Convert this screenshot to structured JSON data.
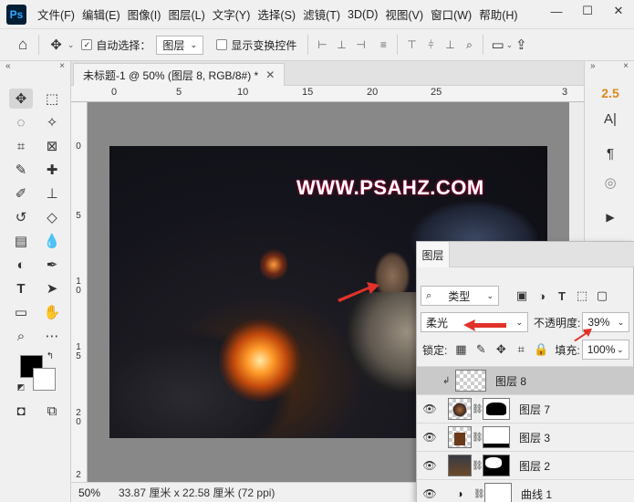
{
  "app": {
    "logo": "Ps"
  },
  "menu": [
    "文件(F)",
    "编辑(E)",
    "图像(I)",
    "图层(L)",
    "文字(Y)",
    "选择(S)",
    "滤镜(T)",
    "3D(D)",
    "视图(V)",
    "窗口(W)",
    "帮助(H)"
  ],
  "window_controls": {
    "minimize": "—",
    "maximize": "☐",
    "close": "✕"
  },
  "options": {
    "auto_select_label": "自动选择：",
    "auto_select_value": "图层",
    "show_transform_label": "显示变换控件"
  },
  "document": {
    "tab_title": "未标题-1 @ 50% (图层 8, RGB/8#) *",
    "zoom": "50%",
    "info": "33.87 厘米 x 22.58 厘米 (72 ppi)",
    "canvas_text": "WWW.PSAHZ.COM"
  },
  "rulers": {
    "h_labels": [
      "0",
      "5",
      "10",
      "15",
      "20",
      "25",
      "3"
    ],
    "v_labels": [
      "0",
      "5",
      "10",
      "15",
      "20",
      "2"
    ]
  },
  "right_panel": {
    "size_value": "2.5"
  },
  "layers_panel": {
    "tab_label": "图层",
    "filter_label": "类型",
    "blend_mode": "柔光",
    "opacity_label": "不透明度:",
    "opacity_value": "39%",
    "lock_label": "锁定:",
    "fill_label": "填充:",
    "fill_value": "100%",
    "layers": [
      {
        "name": "图层 8",
        "selected": true,
        "clipped": true
      },
      {
        "name": "图层 7",
        "selected": false
      },
      {
        "name": "图层 3",
        "selected": false
      },
      {
        "name": "图层 2",
        "selected": false
      },
      {
        "name": "曲线 1",
        "selected": false
      }
    ]
  },
  "colors": {
    "accent_arrow": "#e0322a",
    "size_value": "#d98a1a"
  }
}
